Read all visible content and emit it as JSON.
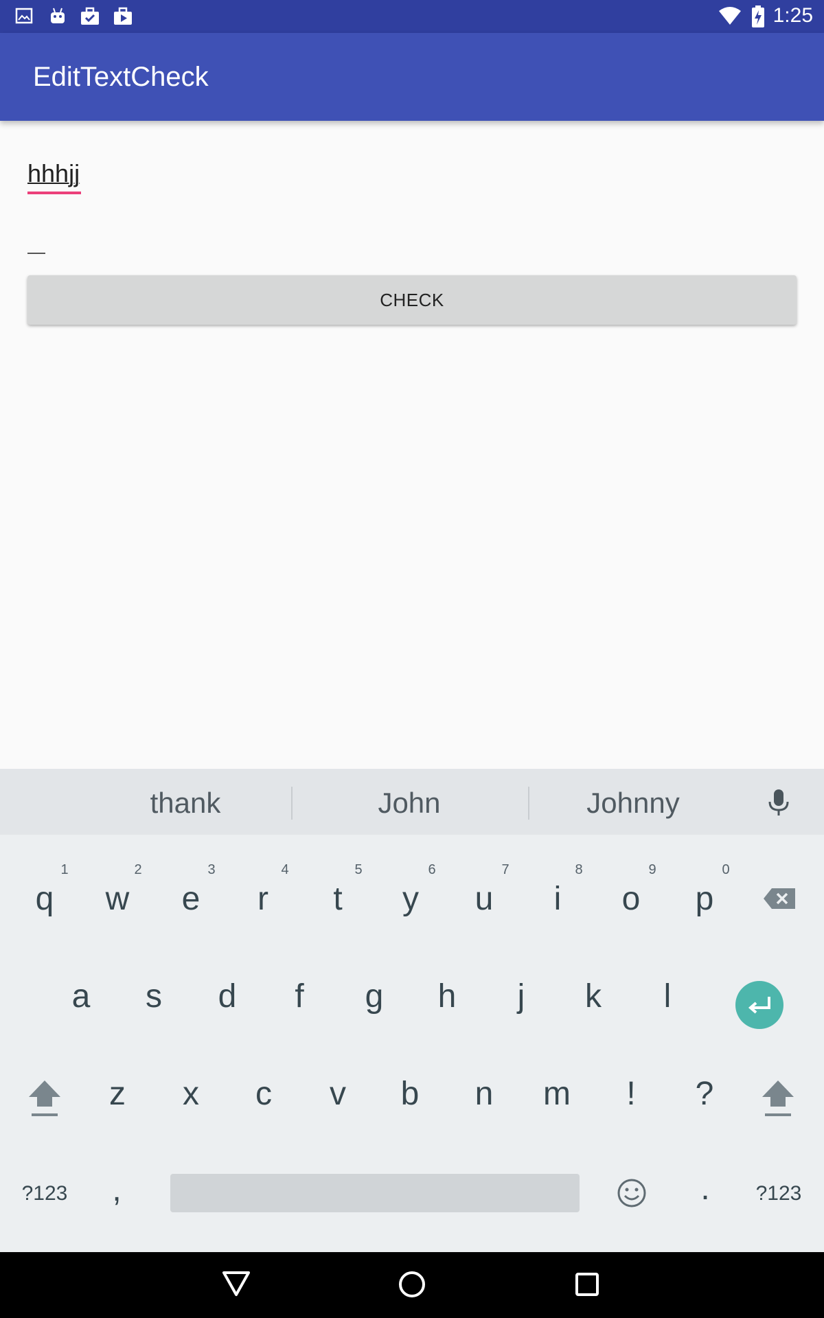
{
  "status_bar": {
    "time": "1:25",
    "icons": [
      "image-icon",
      "android-icon",
      "briefcase-check-icon",
      "briefcase-play-icon",
      "wifi-icon",
      "battery-charging-icon"
    ]
  },
  "app_bar": {
    "title": "EditTextCheck"
  },
  "content": {
    "edit_text_value": "hhhjj",
    "edit_text_2_value": "",
    "check_button_label": "CHECK"
  },
  "keyboard": {
    "suggestions": [
      "thank",
      "John",
      "Johnny"
    ],
    "row1": [
      {
        "key": "q",
        "hint": "1"
      },
      {
        "key": "w",
        "hint": "2"
      },
      {
        "key": "e",
        "hint": "3"
      },
      {
        "key": "r",
        "hint": "4"
      },
      {
        "key": "t",
        "hint": "5"
      },
      {
        "key": "y",
        "hint": "6"
      },
      {
        "key": "u",
        "hint": "7"
      },
      {
        "key": "i",
        "hint": "8"
      },
      {
        "key": "o",
        "hint": "9"
      },
      {
        "key": "p",
        "hint": "0"
      }
    ],
    "row2": [
      "a",
      "s",
      "d",
      "f",
      "g",
      "h",
      "j",
      "k",
      "l"
    ],
    "row3": [
      "z",
      "x",
      "c",
      "v",
      "b",
      "n",
      "m",
      "!",
      "?"
    ],
    "row4": {
      "symbols_left": "?123",
      "comma": ",",
      "period": ".",
      "symbols_right": "?123"
    },
    "enter_color": "#4db6ac"
  },
  "colors": {
    "status_bar": "#303f9f",
    "app_bar": "#3f51b5",
    "accent": "#ec407a"
  }
}
